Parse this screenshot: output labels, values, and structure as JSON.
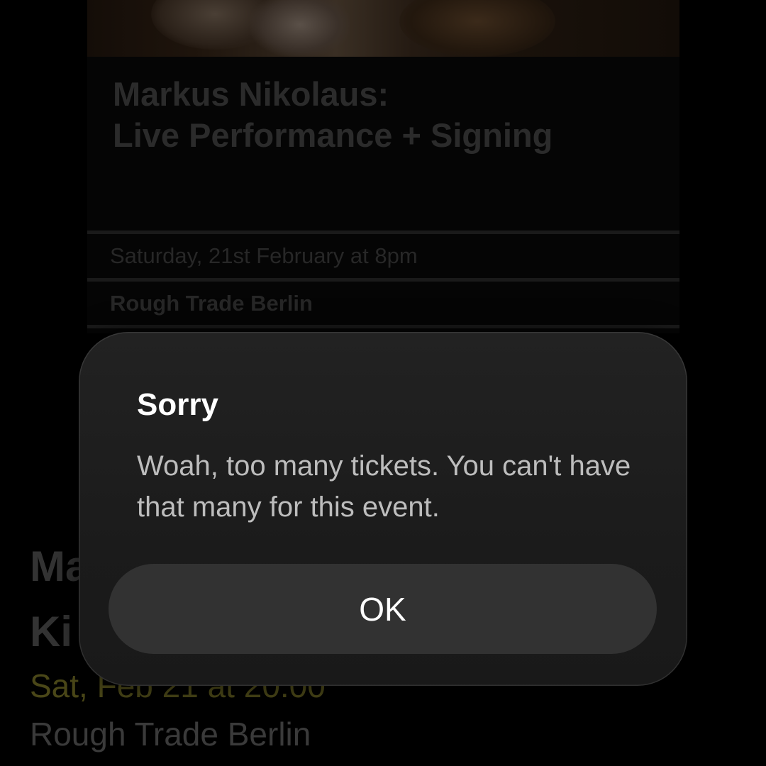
{
  "event_card": {
    "title_line1": "Markus Nikolaus:",
    "title_line2": "Live Performance + Signing",
    "date_time": "Saturday, 21st February at 8pm",
    "venue": "Rough Trade Berlin"
  },
  "list_item": {
    "title_line1_visible": "Ma",
    "title_line2_visible": "Ki",
    "date": "Sat, Feb 21 at 20:00",
    "venue": "Rough Trade Berlin"
  },
  "alert": {
    "title": "Sorry",
    "message": "Woah, too many tickets. You can't have that many for this event.",
    "ok_label": "OK"
  },
  "colors": {
    "background": "#000000",
    "alert_background": "#1e1e1e",
    "alert_button": "#323232",
    "date_accent_dimmed": "#4a4718"
  }
}
